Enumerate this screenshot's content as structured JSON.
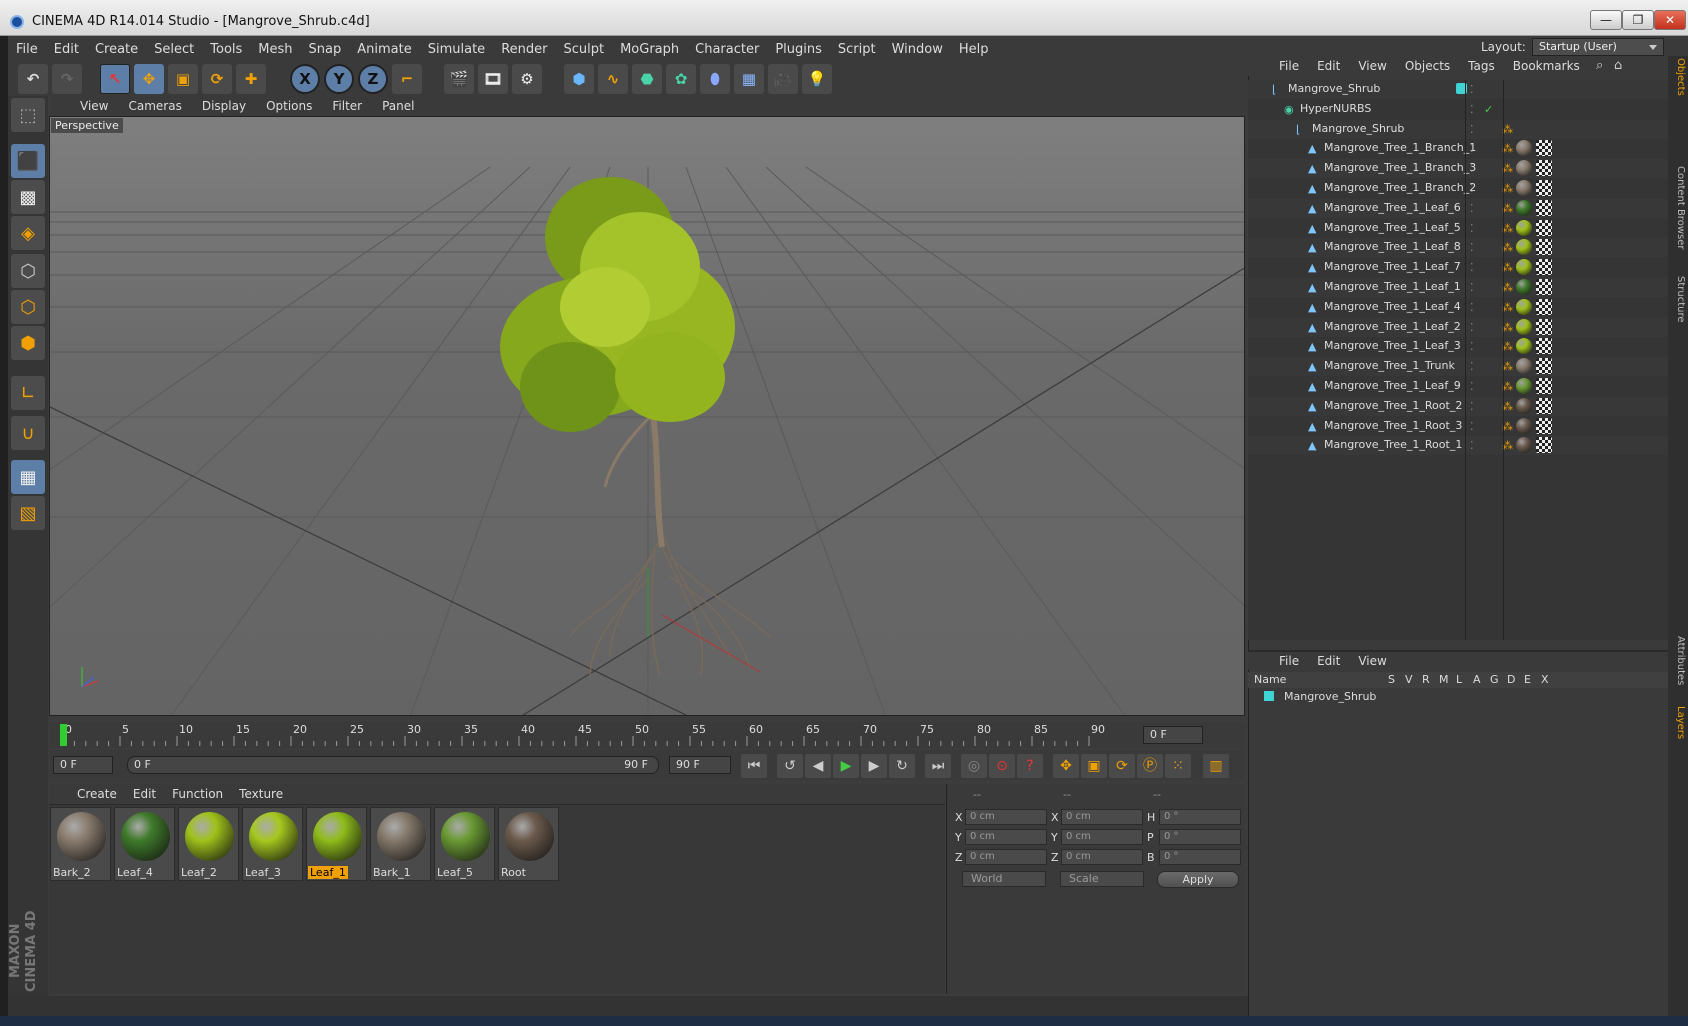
{
  "window": {
    "title": "CINEMA 4D R14.014 Studio - [Mangrove_Shrub.c4d]"
  },
  "menu": [
    "File",
    "Edit",
    "Create",
    "Select",
    "Tools",
    "Mesh",
    "Snap",
    "Animate",
    "Simulate",
    "Render",
    "Sculpt",
    "MoGraph",
    "Character",
    "Plugins",
    "Script",
    "Window",
    "Help"
  ],
  "layout": {
    "label": "Layout:",
    "value": "Startup (User)"
  },
  "toolbar_axes": [
    "X",
    "Y",
    "Z"
  ],
  "viewport": {
    "menu": [
      "View",
      "Cameras",
      "Display",
      "Options",
      "Filter",
      "Panel"
    ],
    "label": "Perspective"
  },
  "timeline": {
    "ticks": [
      "0",
      "5",
      "10",
      "15",
      "20",
      "25",
      "30",
      "35",
      "40",
      "45",
      "50",
      "55",
      "60",
      "65",
      "70",
      "75",
      "80",
      "85",
      "90"
    ],
    "current_frame": "0 F",
    "start_field": "0 F",
    "range_start": "0 F",
    "range_end": "90 F",
    "end_field": "90 F"
  },
  "materials": {
    "menu": [
      "Create",
      "Edit",
      "Function",
      "Texture"
    ],
    "items": [
      {
        "name": "Bark_2",
        "color": "#8a7c6e",
        "selected": false
      },
      {
        "name": "Leaf_4",
        "color": "#3f7a2a",
        "selected": false
      },
      {
        "name": "Leaf_2",
        "color": "#9fc21a",
        "selected": false
      },
      {
        "name": "Leaf_3",
        "color": "#a6c81e",
        "selected": false
      },
      {
        "name": "Leaf_1",
        "color": "#8fbc1a",
        "selected": true
      },
      {
        "name": "Bark_1",
        "color": "#85796b",
        "selected": false
      },
      {
        "name": "Leaf_5",
        "color": "#6a9a34",
        "selected": false
      },
      {
        "name": "Root",
        "color": "#6b5a4c",
        "selected": false
      }
    ]
  },
  "coords": {
    "headers": [
      "--",
      "--",
      "--"
    ],
    "rows": [
      {
        "a": "X",
        "av": "0 cm",
        "b": "X",
        "bv": "0 cm",
        "c": "H",
        "cv": "0 °"
      },
      {
        "a": "Y",
        "av": "0 cm",
        "b": "Y",
        "bv": "0 cm",
        "c": "P",
        "cv": "0 °"
      },
      {
        "a": "Z",
        "av": "0 cm",
        "b": "Z",
        "bv": "0 cm",
        "c": "B",
        "cv": "0 °"
      }
    ],
    "world": "World",
    "scale": "Scale",
    "apply": "Apply"
  },
  "objects": {
    "menu": [
      "File",
      "Edit",
      "View",
      "Objects",
      "Tags",
      "Bookmarks"
    ],
    "items": [
      {
        "name": "Mangrove_Shrub",
        "indent": 0,
        "type": "null"
      },
      {
        "name": "HyperNURBS",
        "indent": 1,
        "type": "nurbs"
      },
      {
        "name": "Mangrove_Shrub",
        "indent": 2,
        "type": "null"
      },
      {
        "name": "Mangrove_Tree_1_Branch_1",
        "indent": 3,
        "type": "poly",
        "mat": "#8a7c6e"
      },
      {
        "name": "Mangrove_Tree_1_Branch_3",
        "indent": 3,
        "type": "poly",
        "mat": "#8a7c6e"
      },
      {
        "name": "Mangrove_Tree_1_Branch_2",
        "indent": 3,
        "type": "poly",
        "mat": "#8a7c6e"
      },
      {
        "name": "Mangrove_Tree_1_Leaf_6",
        "indent": 3,
        "type": "poly",
        "mat": "#3f7a2a"
      },
      {
        "name": "Mangrove_Tree_1_Leaf_5",
        "indent": 3,
        "type": "poly",
        "mat": "#9fc21a"
      },
      {
        "name": "Mangrove_Tree_1_Leaf_8",
        "indent": 3,
        "type": "poly",
        "mat": "#9fc21a"
      },
      {
        "name": "Mangrove_Tree_1_Leaf_7",
        "indent": 3,
        "type": "poly",
        "mat": "#9fc21a"
      },
      {
        "name": "Mangrove_Tree_1_Leaf_1",
        "indent": 3,
        "type": "poly",
        "mat": "#3f7a2a"
      },
      {
        "name": "Mangrove_Tree_1_Leaf_4",
        "indent": 3,
        "type": "poly",
        "mat": "#9fc21a"
      },
      {
        "name": "Mangrove_Tree_1_Leaf_2",
        "indent": 3,
        "type": "poly",
        "mat": "#9fc21a"
      },
      {
        "name": "Mangrove_Tree_1_Leaf_3",
        "indent": 3,
        "type": "poly",
        "mat": "#9fc21a"
      },
      {
        "name": "Mangrove_Tree_1_Trunk",
        "indent": 3,
        "type": "poly",
        "mat": "#8a7c6e"
      },
      {
        "name": "Mangrove_Tree_1_Leaf_9",
        "indent": 3,
        "type": "poly",
        "mat": "#6a9a34"
      },
      {
        "name": "Mangrove_Tree_1_Root_2",
        "indent": 3,
        "type": "poly",
        "mat": "#6b5a4c"
      },
      {
        "name": "Mangrove_Tree_1_Root_3",
        "indent": 3,
        "type": "poly",
        "mat": "#6b5a4c"
      },
      {
        "name": "Mangrove_Tree_1_Root_1",
        "indent": 3,
        "type": "poly",
        "mat": "#6b5a4c"
      }
    ]
  },
  "layers": {
    "menu": [
      "File",
      "Edit",
      "View"
    ],
    "columns": [
      "Name",
      "S",
      "V",
      "R",
      "M",
      "L",
      "A",
      "G",
      "D",
      "E",
      "X"
    ],
    "row": {
      "name": "Mangrove_Shrub",
      "color": "#3fd3d3"
    }
  },
  "side_tabs": [
    "Objects",
    "Content Browser",
    "Structure",
    "Attributes",
    "Layers"
  ],
  "brand": "MAXON CINEMA 4D",
  "colors": {
    "accent": "#f0a000",
    "selection": "#5d7ea6",
    "layer": "#3fd3d3"
  }
}
